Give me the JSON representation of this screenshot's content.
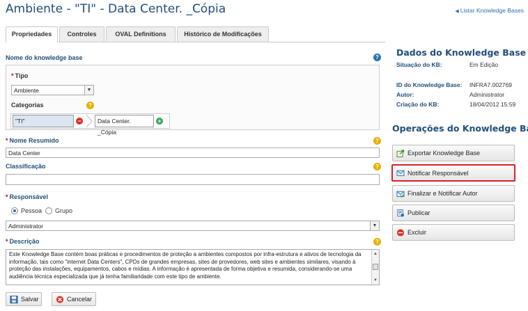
{
  "title": "Ambiente - \"TI\" - Data Center. _Cópia",
  "back_link": "Listar Knowledge Bases",
  "tabs": [
    {
      "label": "Propriedades",
      "active": true
    },
    {
      "label": "Controles",
      "active": false
    },
    {
      "label": "OVAL Definitions",
      "active": false
    },
    {
      "label": "Histórico de Modificações",
      "active": false
    }
  ],
  "form": {
    "name_section": "Nome do knowledge base",
    "tipo_label": "Tipo",
    "tipo_value": "Ambiente",
    "categorias_label": "Categorias",
    "categories": [
      "\"TI\"",
      "Data Center. _Cópia"
    ],
    "nome_resumido_label": "Nome Resumido",
    "nome_resumido_value": "Data Center",
    "classificacao_label": "Classificação",
    "classificacao_value": "",
    "responsavel_label": "Responsável",
    "radio_pessoa": "Pessoa",
    "radio_grupo": "Grupo",
    "responsavel_value": "Administrator",
    "descricao_label": "Descrição",
    "descricao_value": "Este Knowledge Base contém boas práticas e procedimentos de proteção a ambientes compostos por infra-estrutura e ativos de tecnologia da informação, tais como \"internet Data Centers\", CPDs de grandes empresas, sites de provedores, web sites e ambientes similares, visando à proteção das instalações, equipamentos, cabos e mídias. A informação é apresentada de forma objetiva e resumida, considerando-se uma audiência técnica especializada que já tenha familiaridade com este tipo de ambiente."
  },
  "actions": {
    "save": "Salvar",
    "cancel": "Cancelar"
  },
  "kb_data": {
    "title": "Dados do Knowledge Base",
    "situacao_key": "Situação do KB:",
    "situacao_val": "Em Edição",
    "id_key": "ID do Knowledge Base:",
    "id_val": "INFRA7.002769",
    "autor_key": "Autor:",
    "autor_val": "Administrator",
    "criacao_key": "Criação do KB:",
    "criacao_val": "18/04/2012 15:59"
  },
  "operations": {
    "title": "Operações do Knowledge Base",
    "buttons": [
      "Exportar Knowledge Base",
      "Notificar Responsável",
      "Finalizar e Notificar Autor",
      "Publicar",
      "Excluir"
    ]
  },
  "colors": {
    "title_blue": "#1f4e79",
    "highlight_red": "#d2232a",
    "help_yellow": "#e8b000"
  }
}
